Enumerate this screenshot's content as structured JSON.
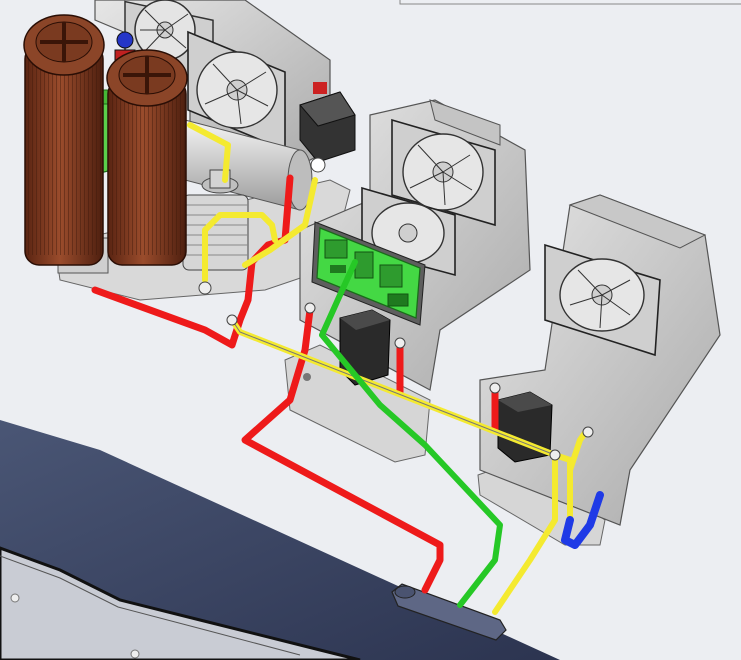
{
  "scene": {
    "background": "#ffffff",
    "floor": "#e9eaee",
    "panel_color": "#3f4a66",
    "housing_color": "#d3d3d3",
    "filter_color": "#7b3a22",
    "pcb_color": "#44d844",
    "pipe_colors": {
      "red": "#ee1a1a",
      "yellow": "#f4ea30",
      "green": "#26c826",
      "blue": "#1f3ae6"
    }
  }
}
